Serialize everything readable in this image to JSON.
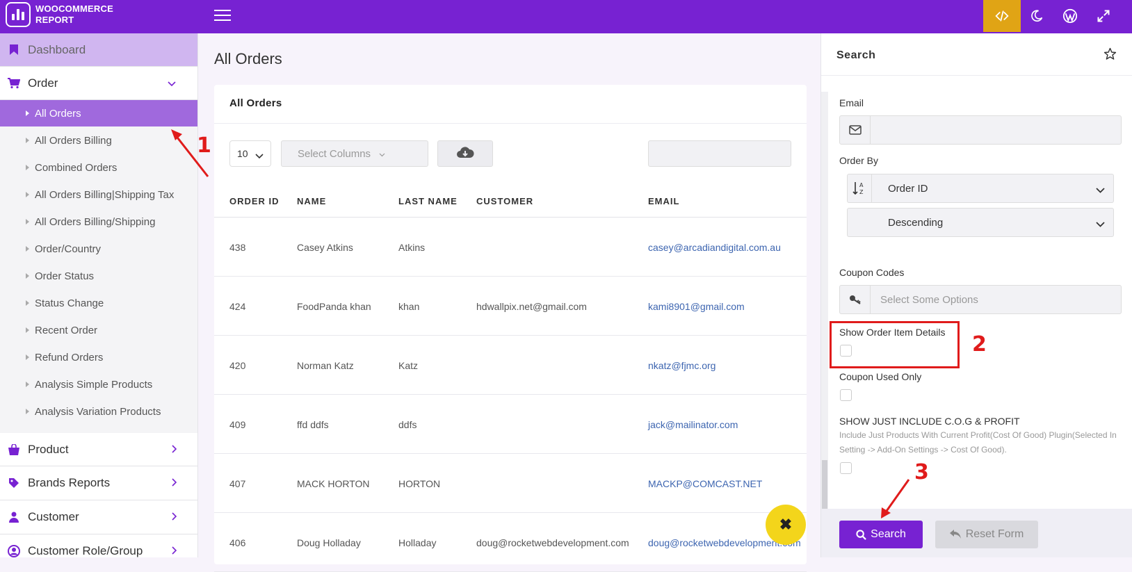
{
  "app": {
    "brand_line1": "WOOCOMMERCE",
    "brand_line2": "REPORT",
    "top_icons": [
      "code-icon",
      "moon-icon",
      "wordpress-icon",
      "expand-icon"
    ],
    "accent": "#7722d2",
    "active_icon_bg": "#e0a415"
  },
  "sidebar": {
    "dashboard": "Dashboard",
    "order": "Order",
    "order_items": [
      "All Orders",
      "All Orders Billing",
      "Combined Orders",
      "All Orders Billing|Shipping Tax",
      "All Orders Billing/Shipping",
      "Order/Country",
      "Order Status",
      "Status Change",
      "Recent Order",
      "Refund Orders",
      "Analysis Simple Products",
      "Analysis Variation Products"
    ],
    "active_item": "All Orders",
    "product": "Product",
    "brands": "Brands Reports",
    "customer": "Customer",
    "customer_role": "Customer Role/Group"
  },
  "main": {
    "page_title": "All Orders",
    "card_title": "All Orders",
    "page_length": "10",
    "select_columns": "Select Columns",
    "columns": [
      "ORDER ID",
      "NAME",
      "LAST NAME",
      "CUSTOMER",
      "EMAIL"
    ],
    "rows": [
      {
        "id": "438",
        "name": "Casey Atkins",
        "last": "Atkins",
        "customer": "",
        "email": "casey@arcadiandigital.com.au"
      },
      {
        "id": "424",
        "name": "FoodPanda khan",
        "last": "khan",
        "customer": "hdwallpix.net@gmail.com",
        "email": "kami8901@gmail.com"
      },
      {
        "id": "420",
        "name": "Norman Katz",
        "last": "Katz",
        "customer": "",
        "email": "nkatz@fjmc.org"
      },
      {
        "id": "409",
        "name": "ffd ddfs",
        "last": "ddfs",
        "customer": "",
        "email": "jack@mailinator.com"
      },
      {
        "id": "407",
        "name": "MACK HORTON",
        "last": "HORTON",
        "customer": "",
        "email": "MACKP@COMCAST.NET"
      },
      {
        "id": "406",
        "name": "Doug Holladay",
        "last": "Holladay",
        "customer": "doug@rocketwebdevelopment.com",
        "email": "doug@rocketwebdevelopment.com"
      }
    ],
    "close_fab": "✖"
  },
  "search_panel": {
    "title": "Search",
    "email_label": "Email",
    "email_value": "",
    "order_by_label": "Order By",
    "order_by_value": "Order ID",
    "order_dir_value": "Descending",
    "coupon_label": "Coupon Codes",
    "coupon_placeholder": "Select Some Options",
    "show_items_label": "Show Order Item Details",
    "coupon_used_label": "Coupon Used Only",
    "cog_label": "SHOW JUST INCLUDE C.O.G & PROFIT",
    "cog_hint": "Include Just Products With Current Profit(Cost Of Good) Plugin(Selected In Setting -> Add-On Settings -> Cost Of Good).",
    "search_button": "Search",
    "reset_button": "Reset Form"
  },
  "annotations": {
    "n1": "1",
    "n2": "2",
    "n3": "3",
    "color": "#e01b1b"
  }
}
